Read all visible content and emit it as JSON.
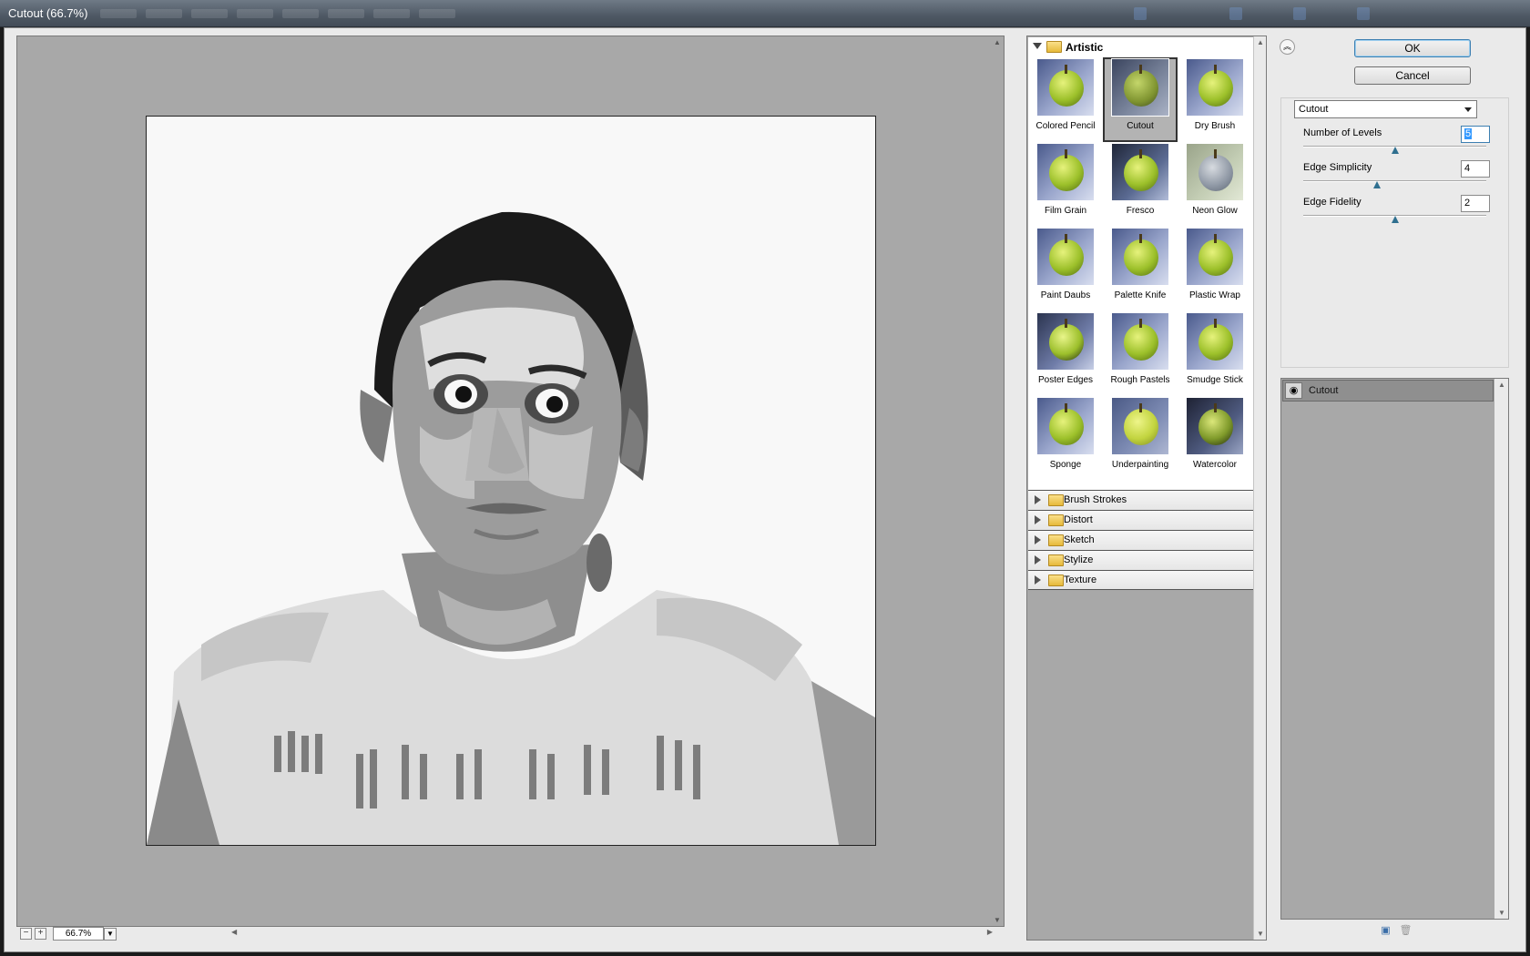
{
  "window": {
    "title": "Cutout (66.7%)"
  },
  "preview": {
    "zoom": "66.7%"
  },
  "gallery": {
    "open_category": "Artistic",
    "filters": [
      "Colored Pencil",
      "Cutout",
      "Dry Brush",
      "Film Grain",
      "Fresco",
      "Neon Glow",
      "Paint Daubs",
      "Palette Knife",
      "Plastic Wrap",
      "Poster Edges",
      "Rough Pastels",
      "Smudge Stick",
      "Sponge",
      "Underpainting",
      "Watercolor"
    ],
    "selected_filter": "Cutout",
    "categories": [
      "Brush Strokes",
      "Distort",
      "Sketch",
      "Stylize",
      "Texture"
    ]
  },
  "buttons": {
    "ok": "OK",
    "cancel": "Cancel"
  },
  "settings": {
    "filter_select": "Cutout",
    "params": [
      {
        "label": "Number of Levels",
        "value": "5",
        "min": 2,
        "max": 8
      },
      {
        "label": "Edge Simplicity",
        "value": "4",
        "min": 0,
        "max": 10
      },
      {
        "label": "Edge Fidelity",
        "value": "2",
        "min": 1,
        "max": 3
      }
    ]
  },
  "layers": {
    "items": [
      "Cutout"
    ]
  },
  "icons": {
    "collapse": "double-chevron-up-icon",
    "eye": "eye-icon",
    "new_layer": "new-effect-layer-icon",
    "delete_layer": "trash-icon"
  },
  "colors": {
    "preview_bg": "#a8a8a8",
    "panel_bg": "#eaeaea",
    "ok_border": "#3c7fb1"
  }
}
